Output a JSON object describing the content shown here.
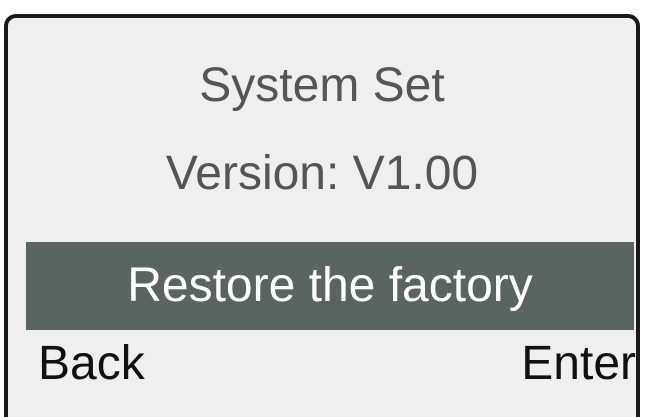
{
  "screen": {
    "title": "System Set",
    "version_label": "Version:",
    "version_value": "V1.00",
    "selected_item": "Restore the factory",
    "softkeys": {
      "left": "Back",
      "right": "Enter"
    }
  },
  "colors": {
    "background": "#efefef",
    "border": "#1a1a1a",
    "text": "#555555",
    "highlight_bg": "#5a6460",
    "highlight_text": "#ffffff",
    "softkey_text": "#111111"
  }
}
